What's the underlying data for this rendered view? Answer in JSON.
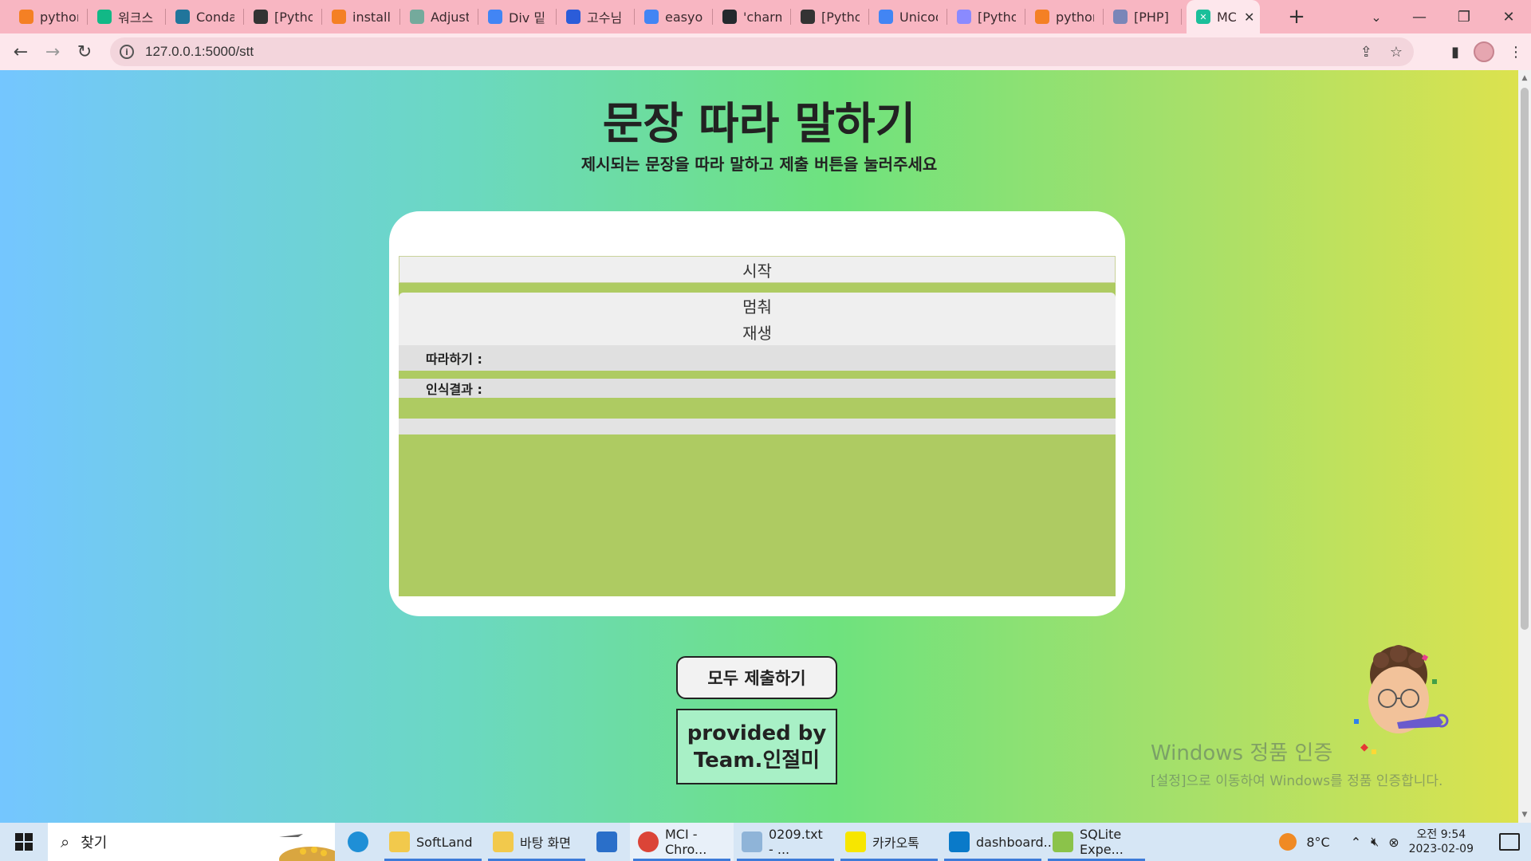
{
  "browser": {
    "tabs": [
      {
        "title": "python",
        "icon": "stackoverflow-icon",
        "color": "#f48024"
      },
      {
        "title": "워크스",
        "icon": "m-logo-icon",
        "color": "#12b886"
      },
      {
        "title": "Conda",
        "icon": "wordpress-icon",
        "color": "#21759b"
      },
      {
        "title": "[Pytho",
        "icon": "dots-icon",
        "color": "#333333"
      },
      {
        "title": "installa",
        "icon": "stackoverflow-icon",
        "color": "#f48024"
      },
      {
        "title": "Adjust",
        "icon": "openai-icon",
        "color": "#74aa9c"
      },
      {
        "title": "Div 밑",
        "icon": "google-icon",
        "color": "#4285f4"
      },
      {
        "title": "고수님",
        "icon": "app-icon",
        "color": "#2b5cd9"
      },
      {
        "title": "easyoc",
        "icon": "google-icon",
        "color": "#4285f4"
      },
      {
        "title": "'charm",
        "icon": "github-icon",
        "color": "#24292e"
      },
      {
        "title": "[Pytho",
        "icon": "dots-icon",
        "color": "#333333"
      },
      {
        "title": "Unicod",
        "icon": "google-icon",
        "color": "#4285f4"
      },
      {
        "title": "[Pytho",
        "icon": "google-icon",
        "color": "#8a8aff"
      },
      {
        "title": "python",
        "icon": "stackoverflow-icon",
        "color": "#f48024"
      },
      {
        "title": "[PHP] V",
        "icon": "php-icon",
        "color": "#7a86b8"
      }
    ],
    "active_tab": {
      "title": "MC",
      "icon": "mci-icon",
      "color": "#1bbf9a"
    },
    "url": "127.0.0.1:5000/stt"
  },
  "page": {
    "title": "문장 따라 말하기",
    "subtitle": "제시되는 문장을 따라 말하고 제출 버튼을 눌러주세요",
    "controls": {
      "start": "시작",
      "stop": "멈춰",
      "play": "재생"
    },
    "fields": {
      "follow_label": "따라하기 :",
      "result_label": "인식결과 :"
    },
    "submit_all": "모두 제출하기",
    "credit": "provided by\nTeam.인절미",
    "watermark_title": "Windows 정품 인증",
    "watermark_sub": "[설정]으로 이동하여 Windows를 정품 인증합니다."
  },
  "taskbar": {
    "search_placeholder": "찾기",
    "apps": [
      {
        "label": "",
        "icon": "edge-icon",
        "color": "#1f8fd6"
      },
      {
        "label": "SoftLand",
        "icon": "folder-icon",
        "color": "#f2c94c",
        "open": true
      },
      {
        "label": "바탕 화면",
        "icon": "folder-icon",
        "color": "#f2c94c",
        "open": true
      },
      {
        "label": "",
        "icon": "mail-icon",
        "color": "#2a6fc9"
      },
      {
        "label": "MCI - Chro...",
        "icon": "chrome-icon",
        "color": "#db4437",
        "open": true,
        "active": true
      },
      {
        "label": "0209.txt - ...",
        "icon": "notepad-icon",
        "color": "#8fb4d8",
        "open": true
      },
      {
        "label": "카카오톡",
        "icon": "kakaotalk-icon",
        "color": "#f7e600",
        "open": true
      },
      {
        "label": "dashboard....",
        "icon": "vscode-icon",
        "color": "#0a7ac9",
        "open": true
      },
      {
        "label": "SQLite Expe...",
        "icon": "sqlite-icon",
        "color": "#8bc34a",
        "open": true
      }
    ],
    "weather": "8°C",
    "time": "오전 9:54",
    "date": "2023-02-09"
  }
}
